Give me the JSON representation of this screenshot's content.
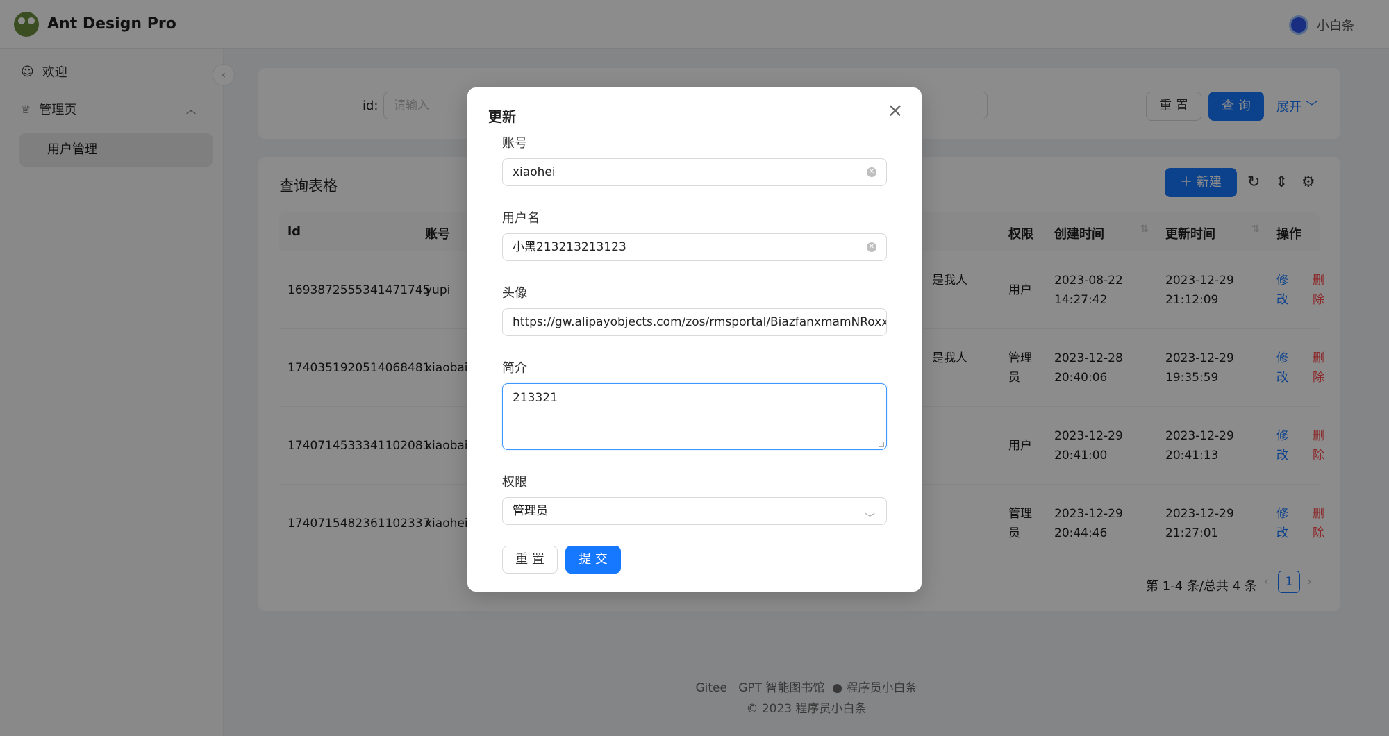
{
  "header": {
    "app_title": "Ant Design Pro",
    "user_name": "小白条"
  },
  "sidebar": {
    "items": [
      {
        "label": "欢迎"
      },
      {
        "label": "管理页"
      }
    ],
    "sub_items": [
      {
        "label": "用户管理"
      }
    ]
  },
  "search": {
    "id_label": "id:",
    "id_placeholder": "请输入",
    "reset_label": "重 置",
    "query_label": "查 询",
    "expand_label": "展开"
  },
  "table": {
    "title": "查询表格",
    "new_label": "新建",
    "columns": [
      "id",
      "账号",
      "权限",
      "创建时间",
      "更新时间",
      "操作"
    ],
    "rows": [
      {
        "id": "1693872555341471745",
        "account": "yupi",
        "bio": "是我人",
        "role": "用户",
        "created_date": "2023-08-22",
        "created_time": "14:27:42",
        "updated_date": "2023-12-29",
        "updated_time": "21:12:09"
      },
      {
        "id": "1740351920514068481",
        "account": "xiaobait",
        "bio": "是我人",
        "role": "管理员",
        "created_date": "2023-12-28",
        "created_time": "20:40:06",
        "updated_date": "2023-12-29",
        "updated_time": "19:35:59"
      },
      {
        "id": "1740714533341102081",
        "account": "xiaobai",
        "bio": "",
        "role": "用户",
        "created_date": "2023-12-29",
        "created_time": "20:41:00",
        "updated_date": "2023-12-29",
        "updated_time": "20:41:13"
      },
      {
        "id": "1740715482361102337",
        "account": "xiaohei",
        "bio": "",
        "role": "管理员",
        "created_date": "2023-12-29",
        "created_time": "20:44:46",
        "updated_date": "2023-12-29",
        "updated_time": "21:27:01"
      }
    ],
    "edit_label": "修改",
    "delete_label": "删除",
    "pagination_text": "第 1-4 条/总共 4 条",
    "current_page": "1"
  },
  "footer": {
    "links": [
      "Gitee",
      "GPT 智能图书馆",
      "程序员小白条"
    ],
    "copyright": "2023 程序员小白条"
  },
  "modal": {
    "title": "更新",
    "fields": {
      "account": {
        "label": "账号",
        "value": "xiaohei"
      },
      "username": {
        "label": "用户名",
        "value": "小黑213213213123"
      },
      "avatar": {
        "label": "头像",
        "value": "https://gw.alipayobjects.com/zos/rmsportal/BiazfanxmamNRoxxVxk"
      },
      "bio": {
        "label": "简介",
        "value": "213321"
      },
      "role": {
        "label": "权限",
        "value": "管理员"
      }
    },
    "reset_label": "重 置",
    "submit_label": "提 交"
  },
  "colors": {
    "primary": "#1677ff",
    "danger": "#ff4d4f",
    "mask": "rgba(0,0,0,0.45)"
  },
  "icons": {
    "close": "close-icon",
    "clear": "close-circle-icon",
    "select": "chevron-down-icon"
  }
}
